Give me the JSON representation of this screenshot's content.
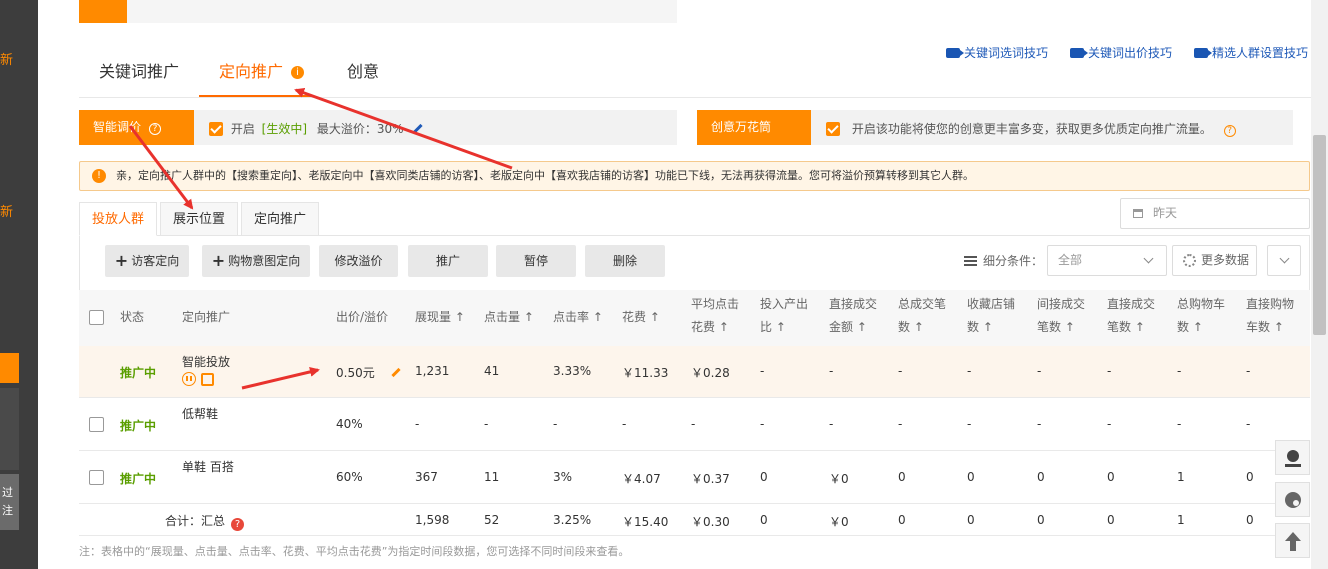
{
  "sidebar": {
    "char1": "新",
    "char2": "新",
    "bottom_line1": "过",
    "bottom_line2": "注"
  },
  "main_tabs": [
    {
      "label": "关键词推广"
    },
    {
      "label": "定向推广"
    },
    {
      "label": "创意"
    }
  ],
  "info_mark": "i",
  "help_links": [
    {
      "label": "关键词选词技巧"
    },
    {
      "label": "关键词出价技巧"
    },
    {
      "label": "精选人群设置技巧"
    }
  ],
  "smart_bid": {
    "label": "智能调价",
    "enabled_label": "开启",
    "status": "[生效中]",
    "max_premium": "最大溢价：30%"
  },
  "creative": {
    "label": "创意万花筒",
    "description": "开启该功能将使您的创意更丰富多变，获取更多优质定向推广流量。"
  },
  "notice": {
    "text": "亲，定向推广人群中的【搜索重定向】、老版定向中【喜欢同类店铺的访客】、老版定向中【喜欢我店铺的访客】功能已下线，无法再获得流量。您可将溢价预算转移到其它人群。"
  },
  "sub_tabs": [
    {
      "label": "投放人群"
    },
    {
      "label": "展示位置"
    },
    {
      "label": "定向推广"
    }
  ],
  "date_picker": {
    "placeholder": "昨天"
  },
  "actions": {
    "visitor": "访客定向",
    "purchase_intent": "购物意图定向",
    "edit_premium": "修改溢价",
    "promote": "推广",
    "pause": "暂停",
    "delete": "删除"
  },
  "filter": {
    "label": "细分条件：",
    "value": "全部",
    "more": "更多数据"
  },
  "table": {
    "headers": {
      "status": "状态",
      "target": "定向推广",
      "bid": "出价/溢价",
      "impressions": "展现量 ↑",
      "clicks": "点击量 ↑",
      "ctr": "点击率 ↑",
      "cost": "花费 ↑",
      "avg_cpc_1": "平均点击",
      "avg_cpc_2": "花费 ↑",
      "roi_1": "投入产出",
      "roi_2": "比 ↑",
      "direct_amt_1": "直接成交",
      "direct_amt_2": "金额 ↑",
      "total_orders_1": "总成交笔",
      "total_orders_2": "数 ↑",
      "fav_shop_1": "收藏店铺",
      "fav_shop_2": "数 ↑",
      "indirect_1": "间接成交",
      "indirect_2": "笔数 ↑",
      "direct_orders_1": "直接成交",
      "direct_orders_2": "笔数 ↑",
      "cart_total_1": "总购物车",
      "cart_total_2": "数 ↑",
      "cart_direct_1": "直接购物",
      "cart_direct_2": "车数 ↑"
    },
    "rows": [
      {
        "status": "推广中",
        "name": "智能投放",
        "bid": "0.50元",
        "impressions": "1,231",
        "clicks": "41",
        "ctr": "3.33%",
        "cost": "￥11.33",
        "avg_cpc": "￥0.28",
        "roi": "-",
        "direct_amt": "-",
        "total_orders": "-",
        "fav_shop": "-",
        "indirect": "-",
        "direct_orders": "-",
        "cart_total": "-",
        "cart_direct": "-"
      },
      {
        "status": "推广中",
        "name": "低帮鞋",
        "bid": "40%",
        "impressions": "-",
        "clicks": "-",
        "ctr": "-",
        "cost": "-",
        "avg_cpc": "-",
        "roi": "-",
        "direct_amt": "-",
        "total_orders": "-",
        "fav_shop": "-",
        "indirect": "-",
        "direct_orders": "-",
        "cart_total": "-",
        "cart_direct": "-"
      },
      {
        "status": "推广中",
        "name": "单鞋 百搭",
        "bid": "60%",
        "impressions": "367",
        "clicks": "11",
        "ctr": "3%",
        "cost": "￥4.07",
        "avg_cpc": "￥0.37",
        "roi": "0",
        "direct_amt": "￥0",
        "total_orders": "0",
        "fav_shop": "0",
        "indirect": "0",
        "direct_orders": "0",
        "cart_total": "1",
        "cart_direct": "0"
      }
    ],
    "total": {
      "label": "合计：汇总",
      "q": "?",
      "impressions": "1,598",
      "clicks": "52",
      "ctr": "3.25%",
      "cost": "￥15.40",
      "avg_cpc": "￥0.30",
      "roi": "0",
      "direct_amt": "￥0",
      "total_orders": "0",
      "fav_shop": "0",
      "indirect": "0",
      "direct_orders": "0",
      "cart_total": "1",
      "cart_direct": "0"
    }
  },
  "footnote": "注：表格中的“展现量、点击量、点击率、花费、平均点击花费”为指定时间段数据，您可选择不同时间段来查看。",
  "colors": {
    "accent": "#ff8a00",
    "active_tab": "#ff6a00",
    "status_green": "#5a9e00",
    "link_blue": "#1f5ab8",
    "arrow_red": "#e8322d"
  }
}
